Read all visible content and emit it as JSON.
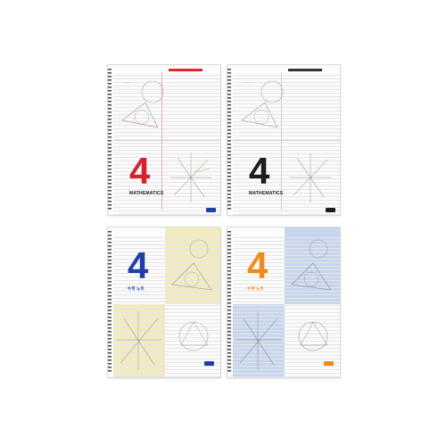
{
  "notebooks": [
    {
      "number": "4",
      "title": "MATHEMATICS",
      "number_color": "#d6222f",
      "label_color": "#e0262f",
      "badge_color": "#1f3fa8"
    },
    {
      "number": "4",
      "title": "MATHEMATICS",
      "number_color": "#1c1c1c",
      "label_color": "#333333",
      "badge_color": "#1c1c1c"
    },
    {
      "number": "4",
      "title": "수학 노트",
      "number_color": "#1f3fa8",
      "tint_color": "#f3ebc0",
      "badge_color": "#1f3fa8"
    },
    {
      "number": "4",
      "title": "수학 노트",
      "number_color": "#f08a1a",
      "tint_color": "#c5d6ee",
      "badge_color": "#f08a1a"
    }
  ]
}
